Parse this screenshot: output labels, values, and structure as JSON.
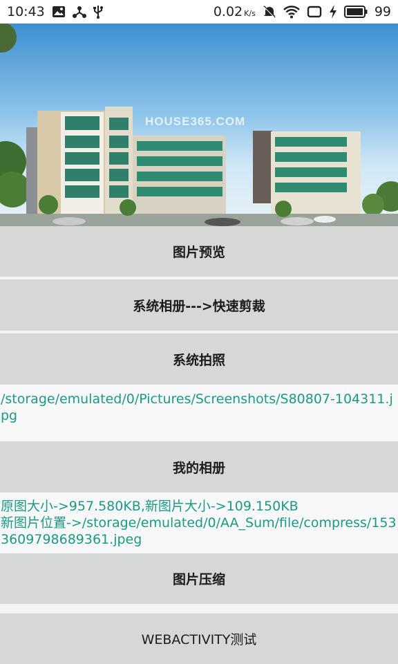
{
  "status_bar": {
    "time": "10:43",
    "speed": "0.02",
    "speed_unit": "K/s",
    "battery": "99",
    "icons": [
      "gallery-icon",
      "usb-share-icon",
      "usb-icon",
      "mute-icon",
      "wifi-icon",
      "screen-icon",
      "charging-icon",
      "battery-icon"
    ]
  },
  "hero": {
    "watermark": "HOUSE365.COM"
  },
  "buttons": {
    "preview": "图片预览",
    "album_crop": "系统相册--->快速剪裁",
    "camera": "系统拍照",
    "my_album": "我的相册",
    "compress": "图片压缩",
    "webactivity": "WEBACTIVITY测试"
  },
  "results": {
    "photo_path": "/storage/emulated/0/Pictures/Screenshots/S80807-104311.jpg",
    "compress_info": "原图大小->957.580KB,新图片大小->109.150KB\n新图片位置->/storage/emulated/0/AA_Sum/file/compress/1533609798689361.jpeg"
  },
  "colors": {
    "button_bg": "#d6d7d7",
    "text_accent": "#1a9a85"
  }
}
